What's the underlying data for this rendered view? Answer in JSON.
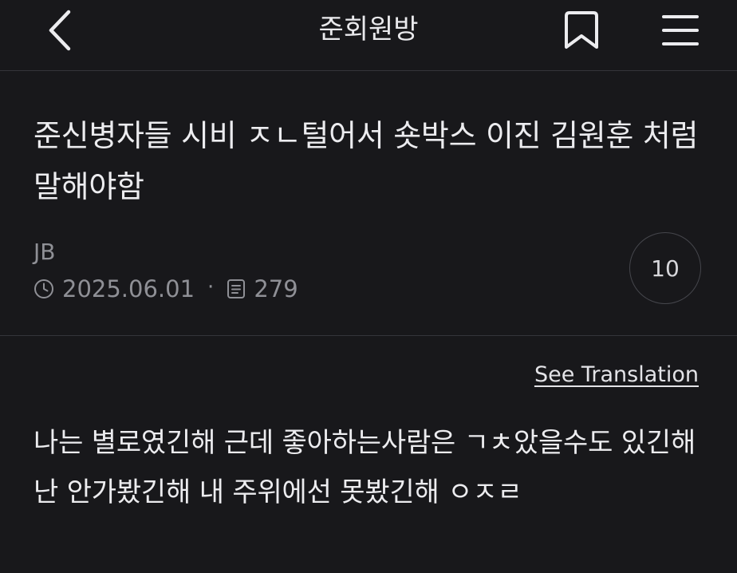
{
  "header": {
    "title": "준회원방",
    "back_icon": "chevron-left-icon",
    "bookmark_icon": "bookmark-icon",
    "menu_icon": "hamburger-menu-icon"
  },
  "post": {
    "title": "준신병자들 시비 ㅈㄴ털어서 숏박스 이진 김원훈 처럼 말해야함",
    "author": "JB",
    "date": "2025.06.01",
    "separator": "·",
    "views": "279",
    "comment_count": "10",
    "translate_label": "See Translation",
    "body": "나는 별로였긴해 근데 좋아하는사람은 ㄱㅊ았을수도 있긴해 난 안가봤긴해 내 주위에선 못봤긴해 ㅇㅈㄹ"
  },
  "colors": {
    "background": "#18181b",
    "text": "#ececef",
    "muted": "#8f9096",
    "divider": "#34353a"
  }
}
